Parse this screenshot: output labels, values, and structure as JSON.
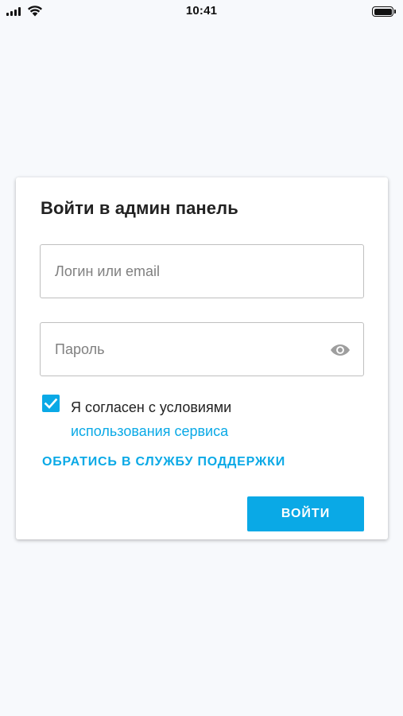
{
  "status_bar": {
    "time": "10:41"
  },
  "login_card": {
    "title": "Войти в админ панель",
    "login_field": {
      "placeholder": "Логин или email",
      "value": ""
    },
    "password_field": {
      "placeholder": "Пароль",
      "value": "",
      "toggle_icon": "eye-icon"
    },
    "agreement": {
      "checked": true,
      "text": "Я согласен с условиями",
      "link_text": "использования сервиса"
    },
    "support_link": "ОБРАТИСЬ В СЛУЖБУ ПОДДЕРЖКИ",
    "submit_label": "ВОЙТИ"
  },
  "colors": {
    "accent": "#0aa9e6",
    "background": "#f7f9fc",
    "card": "#ffffff",
    "title_text": "#222222",
    "placeholder_text": "#808080",
    "field_border": "#bfbfbf",
    "eye_icon": "#9e9e9e"
  }
}
